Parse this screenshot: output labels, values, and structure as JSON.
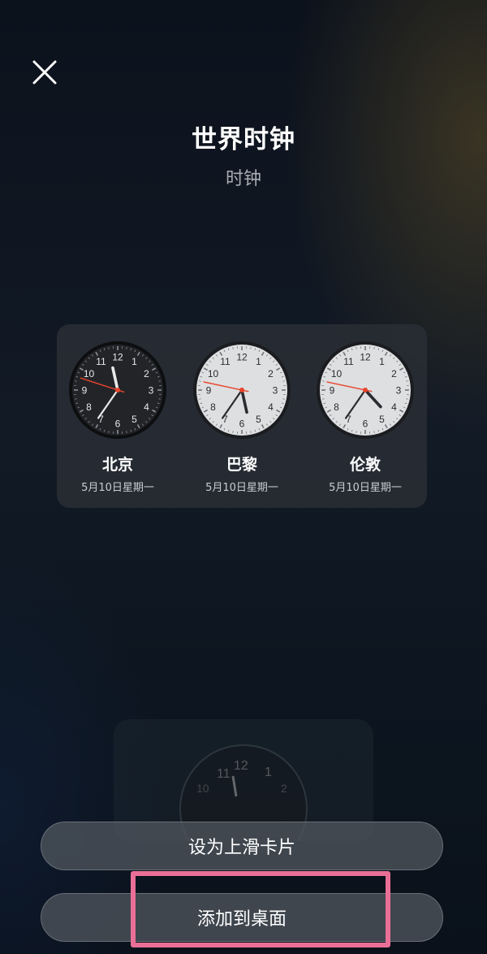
{
  "header": {
    "close_icon": "close-icon",
    "title": "世界时钟",
    "subtitle": "时钟"
  },
  "widget": {
    "clocks": [
      {
        "city": "北京",
        "date": "5月10日星期一",
        "theme": "dark"
      },
      {
        "city": "巴黎",
        "date": "5月10日星期一",
        "theme": "light"
      },
      {
        "city": "伦敦",
        "date": "5月10日星期一",
        "theme": "light"
      }
    ],
    "numerals": [
      "12",
      "1",
      "2",
      "3",
      "4",
      "5",
      "6",
      "7",
      "8",
      "9",
      "10",
      "11"
    ]
  },
  "ghost_preview": {
    "numerals": [
      "11",
      "12",
      "1",
      "10",
      "2"
    ]
  },
  "buttons": {
    "swipe_card": "设为上滑卡片",
    "add_to_desktop": "添加到桌面"
  },
  "colors": {
    "second_hand": "#e8442c",
    "highlight": "#ea6f97",
    "dark_face": "#222428",
    "light_face": "#dedfe0"
  }
}
